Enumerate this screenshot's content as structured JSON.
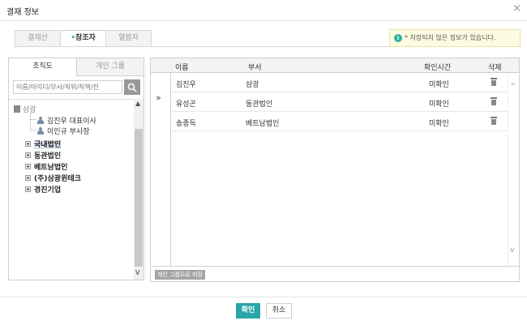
{
  "dialog": {
    "title": "결재 정보",
    "close_glyph": "×"
  },
  "tabs": [
    {
      "label": "결재선",
      "active": false
    },
    {
      "label": "참조자",
      "active": true,
      "marker": "•"
    },
    {
      "label": "열람자",
      "active": false
    }
  ],
  "notice": {
    "icon": "info-icon",
    "icon_glyph": "i",
    "text": "* 저장되지 않은 정보가 있습니다."
  },
  "left": {
    "tabs": [
      {
        "label": "조직도",
        "active": true
      },
      {
        "label": "개인 그룹",
        "active": false
      }
    ],
    "search": {
      "placeholder": "이름/아이디/부서/직위/직책/전"
    },
    "tree": {
      "company": "삼광",
      "persons": [
        "김진우 대표이사",
        "이인규 부사장"
      ],
      "depts": [
        "국내법인",
        "동관법인",
        "베트남법인",
        "(주)삼광윈테크",
        "경진기업"
      ],
      "selected_dept": "국내법인"
    },
    "scroll": {
      "up": "▲",
      "down": "V"
    }
  },
  "right": {
    "columns": {
      "name": "이름",
      "dept": "부서",
      "confirm_time": "확인시간",
      "delete": "삭제"
    },
    "move_glyph": "»",
    "rows": [
      {
        "name": "김진우",
        "dept": "삼광",
        "status": "미확인"
      },
      {
        "name": "유성곤",
        "dept": "동관법인",
        "status": "미확인"
      },
      {
        "name": "송종득",
        "dept": "베트남법인",
        "status": "미확인"
      }
    ],
    "scroll": {
      "up": "^",
      "down": "v"
    },
    "save_group_label": "개인 그룹으로 저장"
  },
  "buttons": {
    "ok": "확인",
    "cancel": "취소"
  },
  "colors": {
    "accent": "#2aa5a8",
    "notice_bg": "#fdfbe0",
    "selected_bg": "#dde7f2"
  }
}
